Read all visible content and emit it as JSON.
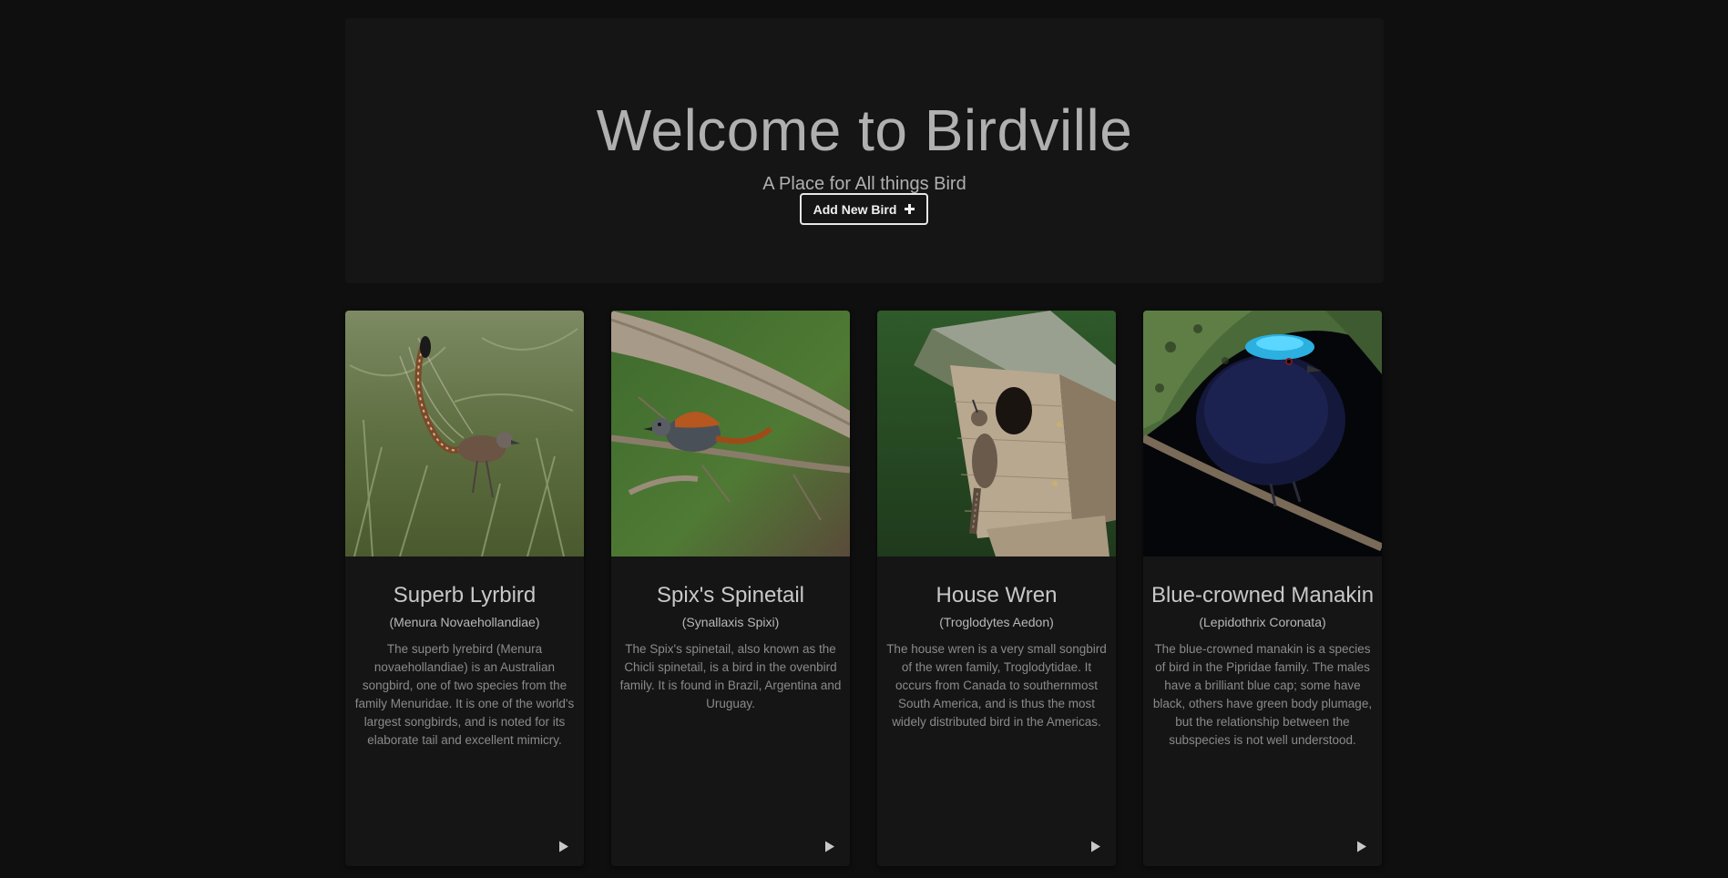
{
  "hero": {
    "title": "Welcome to Birdville",
    "subtitle": "A Place for All things Bird",
    "add_button_label": "Add New Bird",
    "add_button_icon": "plus-icon"
  },
  "cards": [
    {
      "name": "Superb Lyrbird",
      "scientific": "(Menura Novaehollandiae)",
      "description": "The superb lyrebird (Menura novaehollandiae) is an Australian songbird, one of two species from the family Menuridae. It is one of the world's largest songbirds, and is noted for its elaborate tail and excellent mimicry.",
      "action_icon": "play-icon"
    },
    {
      "name": "Spix's Spinetail",
      "scientific": "(Synallaxis Spixi)",
      "description": "The Spix's spinetail, also known as the Chicli spinetail, is a bird in the ovenbird family. It is found in Brazil, Argentina and Uruguay.",
      "action_icon": "play-icon"
    },
    {
      "name": "House Wren",
      "scientific": "(Troglodytes Aedon)",
      "description": "The house wren is a very small songbird of the wren family, Troglodytidae. It occurs from Canada to southernmost South America, and is thus the most widely distributed bird in the Americas.",
      "action_icon": "play-icon"
    },
    {
      "name": "Blue-crowned Manakin",
      "scientific": "(Lepidothrix Coronata)",
      "description": "The blue-crowned manakin is a species of bird in the Pipridae family. The males have a brilliant blue cap; some have black, others have green body plumage, but the relationship between the subspecies is not well understood.",
      "action_icon": "play-icon"
    }
  ],
  "colors": {
    "page_background": "#0f0f0f",
    "panel_background": "#151515",
    "heading_text": "#b0b0b0",
    "body_text": "#8a8a8a"
  }
}
